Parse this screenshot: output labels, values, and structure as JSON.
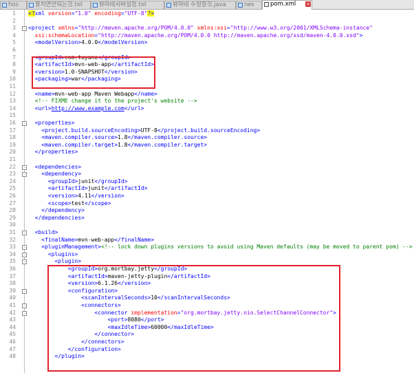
{
  "tabs": [
    {
      "label": "hosts"
    },
    {
      "label": "뭉치면안되는것.txt"
    },
    {
      "label": "뷰마테서버설정.txt"
    },
    {
      "label": "뷰마테 수정할것.java"
    },
    {
      "label": "new 1"
    },
    {
      "label": "pom.xml",
      "active": true
    }
  ],
  "lines": [
    {
      "n": "1",
      "segs": [
        [
          "pi",
          "<?"
        ],
        [
          "tag",
          "xml "
        ],
        [
          "attr",
          "version"
        ],
        [
          "tag",
          "="
        ],
        [
          "str",
          "\"1.0\" "
        ],
        [
          "attr",
          "encoding"
        ],
        [
          "tag",
          "="
        ],
        [
          "str",
          "\"UTF-8\""
        ],
        [
          "pi",
          "?>"
        ]
      ]
    },
    {
      "n": "2",
      "segs": []
    },
    {
      "n": "3",
      "segs": [
        [
          "tag",
          "<project "
        ],
        [
          "attr",
          "xmlns"
        ],
        [
          "tag",
          "="
        ],
        [
          "str",
          "\"http://maven.apache.org/POM/4.0.0\" "
        ],
        [
          "attr",
          "xmlns:xsi"
        ],
        [
          "tag",
          "="
        ],
        [
          "str",
          "\"http://www.w3.org/2001/XMLSchema-instance\""
        ]
      ]
    },
    {
      "n": "4",
      "segs": [
        [
          "txt",
          "  "
        ],
        [
          "attr",
          "xsi:schemaLocation"
        ],
        [
          "tag",
          "="
        ],
        [
          "str",
          "\"http://maven.apache.org/POM/4.0.0 http://maven.apache.org/xsd/maven-4.0.0.xsd\""
        ],
        [
          "tag",
          ">"
        ]
      ]
    },
    {
      "n": "5",
      "segs": [
        [
          "txt",
          "  "
        ],
        [
          "tag",
          "<modelVersion>"
        ],
        [
          "txt",
          "4.0.0"
        ],
        [
          "tag",
          "</modelVersion>"
        ]
      ]
    },
    {
      "n": "6",
      "segs": []
    },
    {
      "n": "7",
      "segs": [
        [
          "txt",
          "  "
        ],
        [
          "tag",
          "<groupId>"
        ],
        [
          "txt",
          "com.tuyano"
        ],
        [
          "tag",
          "</groupId>"
        ]
      ]
    },
    {
      "n": "8",
      "segs": [
        [
          "txt",
          "  "
        ],
        [
          "tag",
          "<artifactId>"
        ],
        [
          "txt",
          "mvn-web-app"
        ],
        [
          "tag",
          "</artifactId>"
        ]
      ]
    },
    {
      "n": "9",
      "segs": [
        [
          "txt",
          "  "
        ],
        [
          "tag",
          "<version>"
        ],
        [
          "txt",
          "1.0-SNAPSHOT"
        ],
        [
          "tag",
          "</version>"
        ]
      ]
    },
    {
      "n": "10",
      "segs": [
        [
          "txt",
          "  "
        ],
        [
          "tag",
          "<packaging>"
        ],
        [
          "txt",
          "war"
        ],
        [
          "tag",
          "</packaging>"
        ]
      ]
    },
    {
      "n": "11",
      "segs": []
    },
    {
      "n": "12",
      "segs": [
        [
          "txt",
          "  "
        ],
        [
          "tag",
          "<name>"
        ],
        [
          "txt",
          "mvn-web-app Maven Webapp"
        ],
        [
          "tag",
          "</name>"
        ]
      ]
    },
    {
      "n": "13",
      "segs": [
        [
          "txt",
          "  "
        ],
        [
          "com",
          "<!-- FIXME change it to the project's website -->"
        ]
      ]
    },
    {
      "n": "14",
      "segs": [
        [
          "txt",
          "  "
        ],
        [
          "tag",
          "<url>"
        ],
        [
          "url",
          "http://www.example.com"
        ],
        [
          "tag",
          "</url>"
        ]
      ]
    },
    {
      "n": "15",
      "segs": []
    },
    {
      "n": "16",
      "segs": [
        [
          "txt",
          "  "
        ],
        [
          "tag",
          "<properties>"
        ]
      ]
    },
    {
      "n": "17",
      "segs": [
        [
          "txt",
          "    "
        ],
        [
          "tag",
          "<project.build.sourceEncoding>"
        ],
        [
          "txt",
          "UTF-8"
        ],
        [
          "tag",
          "</project.build.sourceEncoding>"
        ]
      ]
    },
    {
      "n": "18",
      "segs": [
        [
          "txt",
          "    "
        ],
        [
          "tag",
          "<maven.compiler.source>"
        ],
        [
          "txt",
          "1.8"
        ],
        [
          "tag",
          "</maven.compiler.source>"
        ]
      ]
    },
    {
      "n": "19",
      "segs": [
        [
          "txt",
          "    "
        ],
        [
          "tag",
          "<maven.compiler.target>"
        ],
        [
          "txt",
          "1.8"
        ],
        [
          "tag",
          "</maven.compiler.target>"
        ]
      ]
    },
    {
      "n": "20",
      "segs": [
        [
          "txt",
          "  "
        ],
        [
          "tag",
          "</properties>"
        ]
      ]
    },
    {
      "n": "21",
      "segs": []
    },
    {
      "n": "22",
      "segs": [
        [
          "txt",
          "  "
        ],
        [
          "tag",
          "<dependencies>"
        ]
      ]
    },
    {
      "n": "23",
      "segs": [
        [
          "txt",
          "    "
        ],
        [
          "tag",
          "<dependency>"
        ]
      ]
    },
    {
      "n": "24",
      "segs": [
        [
          "txt",
          "      "
        ],
        [
          "tag",
          "<groupId>"
        ],
        [
          "txt",
          "junit"
        ],
        [
          "tag",
          "</groupId>"
        ]
      ]
    },
    {
      "n": "25",
      "segs": [
        [
          "txt",
          "      "
        ],
        [
          "tag",
          "<artifactId>"
        ],
        [
          "txt",
          "junit"
        ],
        [
          "tag",
          "</artifactId>"
        ]
      ]
    },
    {
      "n": "26",
      "segs": [
        [
          "txt",
          "      "
        ],
        [
          "tag",
          "<version>"
        ],
        [
          "txt",
          "4.11"
        ],
        [
          "tag",
          "</version>"
        ]
      ]
    },
    {
      "n": "27",
      "segs": [
        [
          "txt",
          "      "
        ],
        [
          "tag",
          "<scope>"
        ],
        [
          "txt",
          "test"
        ],
        [
          "tag",
          "</scope>"
        ]
      ]
    },
    {
      "n": "28",
      "segs": [
        [
          "txt",
          "    "
        ],
        [
          "tag",
          "</dependency>"
        ]
      ]
    },
    {
      "n": "29",
      "segs": [
        [
          "txt",
          "  "
        ],
        [
          "tag",
          "</dependencies>"
        ]
      ]
    },
    {
      "n": "30",
      "segs": []
    },
    {
      "n": "31",
      "segs": [
        [
          "txt",
          "  "
        ],
        [
          "tag",
          "<build>"
        ]
      ]
    },
    {
      "n": "32",
      "segs": [
        [
          "txt",
          "    "
        ],
        [
          "tag",
          "<finalName>"
        ],
        [
          "txt",
          "mvn-web-app"
        ],
        [
          "tag",
          "</finalName>"
        ]
      ]
    },
    {
      "n": "33",
      "segs": [
        [
          "txt",
          "    "
        ],
        [
          "tag",
          "<pluginManagement>"
        ],
        [
          "com",
          "<!-- lock down plugins versions to avoid using Maven defaults (may be moved to parent pom) -->"
        ]
      ]
    },
    {
      "n": "34",
      "segs": [
        [
          "txt",
          "      "
        ],
        [
          "tag",
          "<plugins>"
        ]
      ]
    },
    {
      "n": "35",
      "segs": [
        [
          "txt",
          "        "
        ],
        [
          "tag",
          "<plugin>"
        ]
      ]
    },
    {
      "n": "36",
      "segs": [
        [
          "txt",
          "            "
        ],
        [
          "tag",
          "<groupId>"
        ],
        [
          "txt",
          "org.mortbay.jetty"
        ],
        [
          "tag",
          "</groupId>"
        ]
      ]
    },
    {
      "n": "37",
      "segs": [
        [
          "txt",
          "            "
        ],
        [
          "tag",
          "<artifactId>"
        ],
        [
          "txt",
          "maven-jetty-plugin"
        ],
        [
          "tag",
          "</artifactId>"
        ]
      ]
    },
    {
      "n": "38",
      "segs": [
        [
          "txt",
          "            "
        ],
        [
          "tag",
          "<version>"
        ],
        [
          "txt",
          "6.1.26"
        ],
        [
          "tag",
          "</version>"
        ]
      ]
    },
    {
      "n": "39",
      "segs": [
        [
          "txt",
          "            "
        ],
        [
          "tag",
          "<configuration>"
        ]
      ]
    },
    {
      "n": "40",
      "segs": [
        [
          "txt",
          "                "
        ],
        [
          "tag",
          "<scanIntervalSeconds>"
        ],
        [
          "txt",
          "10"
        ],
        [
          "tag",
          "</scanIntervalSeconds>"
        ]
      ]
    },
    {
      "n": "41",
      "segs": [
        [
          "txt",
          "                "
        ],
        [
          "tag",
          "<connectors>"
        ]
      ]
    },
    {
      "n": "42",
      "segs": [
        [
          "txt",
          "                    "
        ],
        [
          "tag",
          "<connector "
        ],
        [
          "attr",
          "implementation"
        ],
        [
          "tag",
          "="
        ],
        [
          "str",
          "\"org.mortbay.jetty.nio.SelectChannelConnector\""
        ],
        [
          "tag",
          ">"
        ]
      ]
    },
    {
      "n": "43",
      "segs": [
        [
          "txt",
          "                        "
        ],
        [
          "tag",
          "<port>"
        ],
        [
          "txt",
          "8080"
        ],
        [
          "tag",
          "</port>"
        ]
      ]
    },
    {
      "n": "44",
      "segs": [
        [
          "txt",
          "                        "
        ],
        [
          "tag",
          "<maxIdleTime>"
        ],
        [
          "txt",
          "60000"
        ],
        [
          "tag",
          "</maxIdleTime>"
        ]
      ]
    },
    {
      "n": "45",
      "segs": [
        [
          "txt",
          "                    "
        ],
        [
          "tag",
          "</connector>"
        ]
      ]
    },
    {
      "n": "46",
      "segs": [
        [
          "txt",
          "                "
        ],
        [
          "tag",
          "</connectors>"
        ]
      ]
    },
    {
      "n": "47",
      "segs": [
        [
          "txt",
          "            "
        ],
        [
          "tag",
          "</configuration>"
        ]
      ]
    },
    {
      "n": "48",
      "segs": [
        [
          "txt",
          "        "
        ],
        [
          "tag",
          "</plugin>"
        ]
      ]
    }
  ]
}
